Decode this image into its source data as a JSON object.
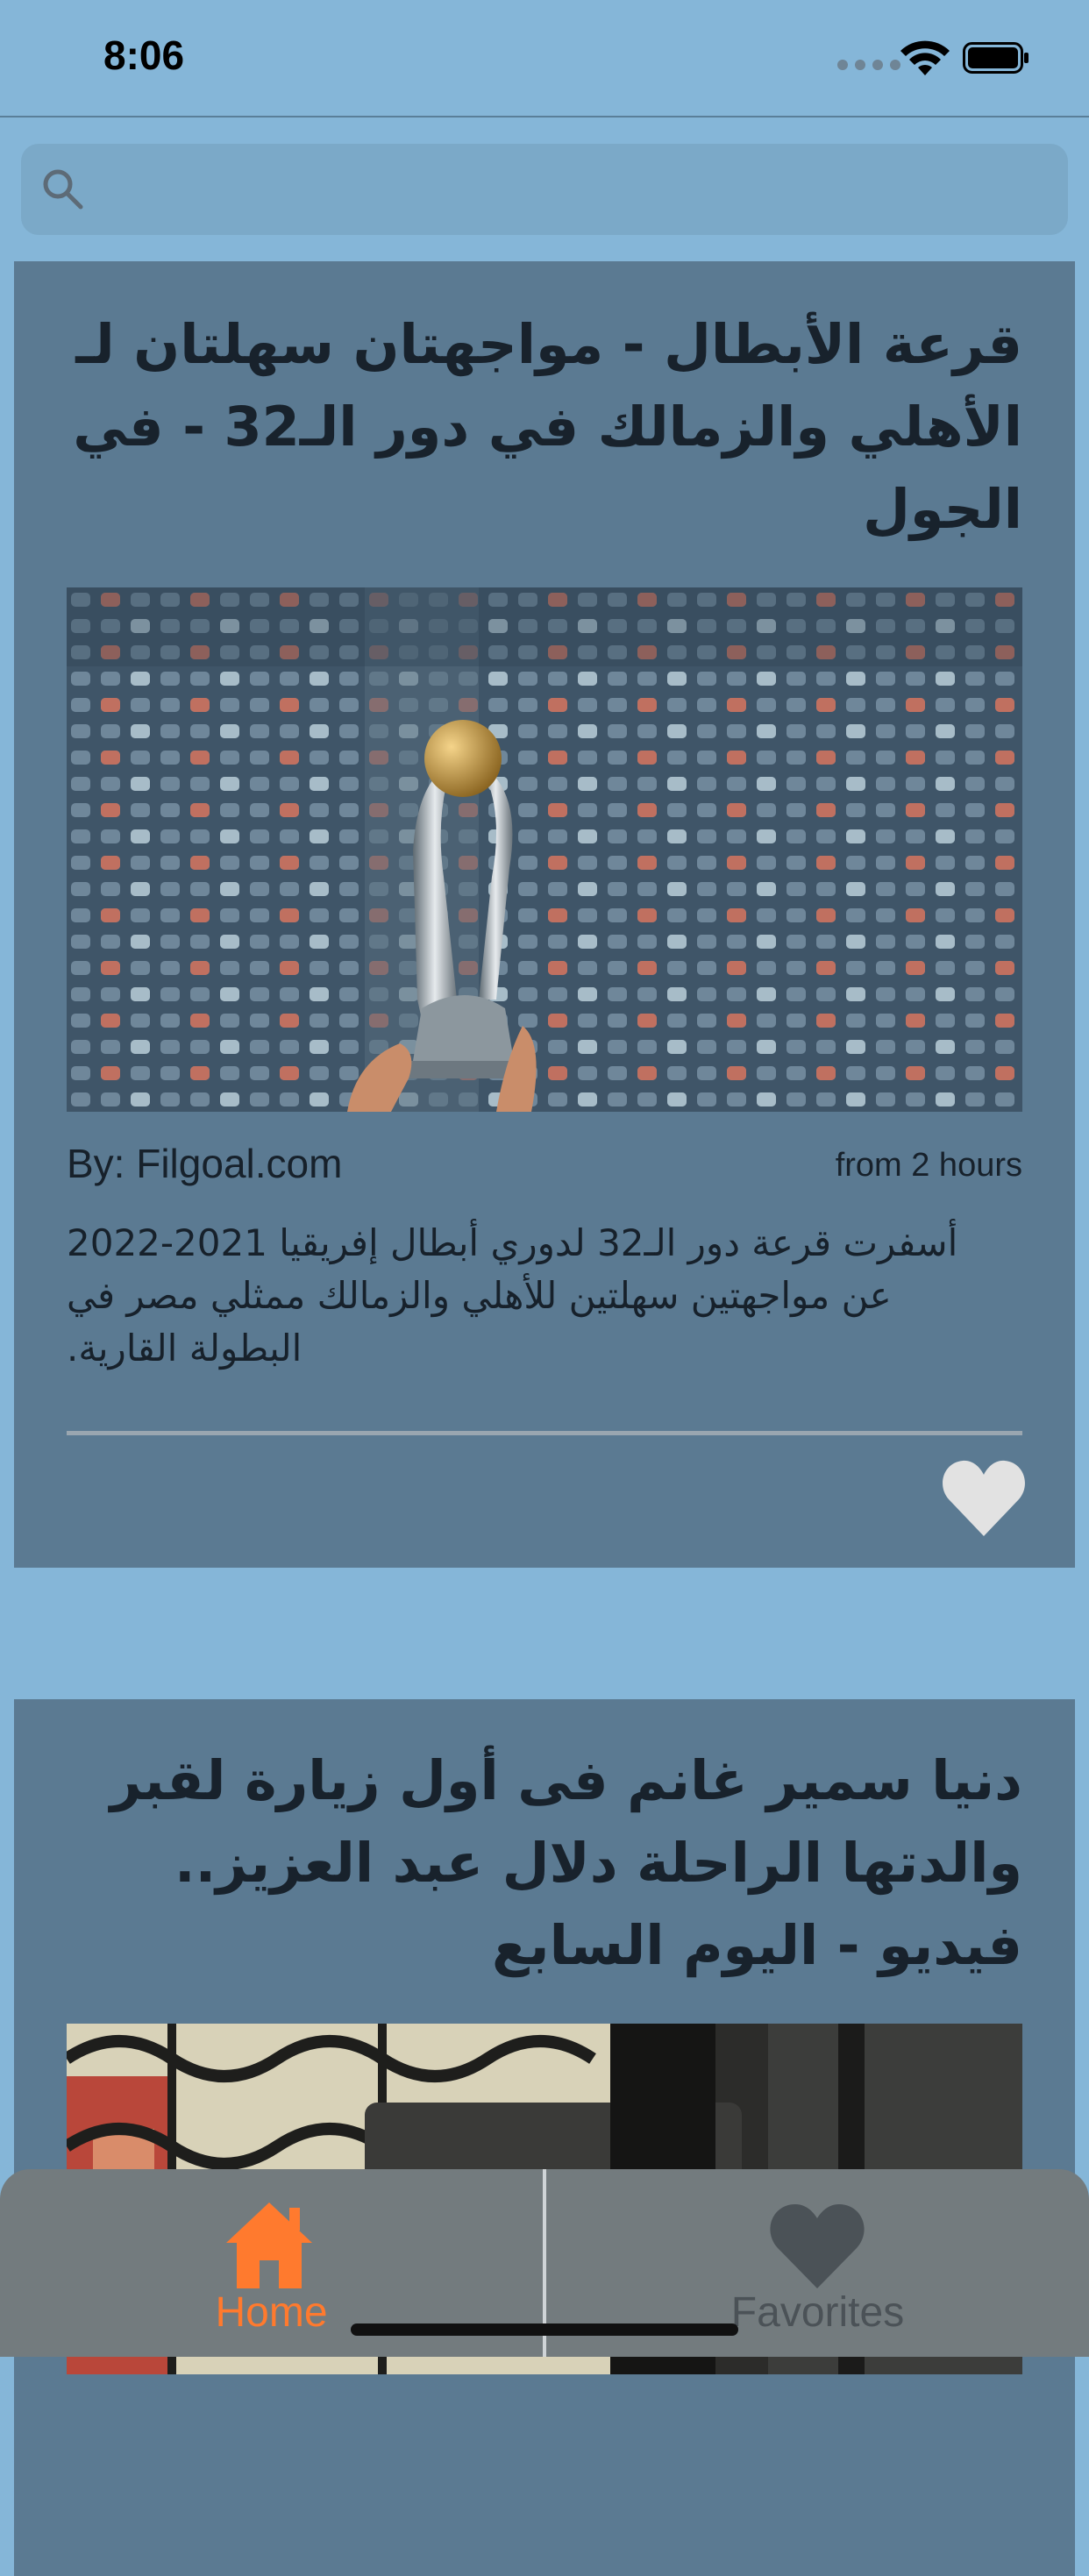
{
  "status_bar": {
    "time": "8:06"
  },
  "search": {
    "placeholder": "",
    "value": ""
  },
  "articles": [
    {
      "title": "قرعة الأبطال - مواجهتان سهلتان لـ الأهلي والزمالك في دور الـ32 - في الجول",
      "author": "By: Filgoal.com",
      "time": "from 2 hours",
      "description": "أسفرت قرعة دور الـ32 لدوري أبطال إفريقيا 2021-2022 عن مواجهتين سهلتين للأهلي والزمالك ممثلي مصر في البطولة القارية.",
      "favorite": false
    },
    {
      "title": "دنيا سمير غانم فى أول زيارة لقبر والدتها الراحلة دلال عبد العزيز.. فيديو - اليوم السابع"
    }
  ],
  "tabs": [
    {
      "label": "Home",
      "icon": "house-icon",
      "active": true
    },
    {
      "label": "Favorites",
      "icon": "heart-icon",
      "active": false
    }
  ],
  "colors": {
    "background": "#85b6d8",
    "card": "#5b7a92",
    "tab_bar": "#737b7e",
    "accent": "#ff7a2e"
  }
}
